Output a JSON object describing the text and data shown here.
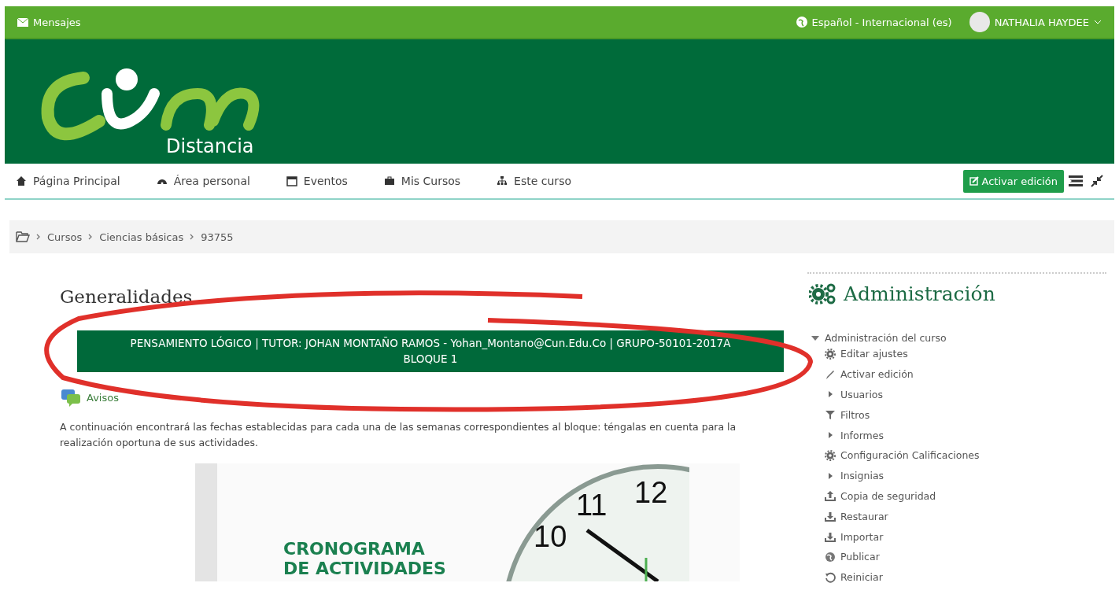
{
  "top_bar": {
    "messages": "Mensajes",
    "language": "Español - Internacional (es)",
    "user": "NATHALIA HAYDEE"
  },
  "logo": {
    "subtitle": "Distancia"
  },
  "nav": {
    "items": [
      {
        "label": "Página Principal"
      },
      {
        "label": "Área personal"
      },
      {
        "label": "Eventos"
      },
      {
        "label": "Mis Cursos"
      },
      {
        "label": "Este curso"
      }
    ],
    "edit_button": "Activar edición"
  },
  "breadcrumb": [
    "Cursos",
    "Ciencias básicas",
    "93755"
  ],
  "main": {
    "title": "Generalidades",
    "banner": [
      "PENSAMIENTO LÓGICO | TUTOR: JOHAN MONTAÑO RAMOS - Yohan_Montano@Cun.Edu.Co | GRUPO-50101-2017A",
      "BLOQUE 1"
    ],
    "forum_link": "Avisos",
    "intro": "A continuación encontrará las fechas establecidas para cada una de las semanas correspondientes al bloque: téngalas en cuenta para la realización oportuna de sus actividades.",
    "image": {
      "title_lines": [
        "CRONOGRAMA",
        "DE ACTIVIDADES"
      ],
      "clock_numbers": [
        "11",
        "12",
        "10"
      ]
    }
  },
  "admin": {
    "title": "Administración",
    "section": {
      "label": "Administración del curso",
      "expanded": true,
      "children": [
        {
          "label": "Editar ajustes",
          "kind": "gear"
        },
        {
          "label": "Activar edición",
          "kind": "pencil"
        },
        {
          "label": "Usuarios",
          "kind": "folder"
        },
        {
          "label": "Filtros",
          "kind": "filter"
        },
        {
          "label": "Informes",
          "kind": "folder"
        },
        {
          "label": "Configuración Calificaciones",
          "kind": "gear"
        },
        {
          "label": "Insignias",
          "kind": "folder"
        },
        {
          "label": "Copia de seguridad",
          "kind": "upload"
        },
        {
          "label": "Restaurar",
          "kind": "download"
        },
        {
          "label": "Importar",
          "kind": "download"
        },
        {
          "label": "Publicar",
          "kind": "globe"
        },
        {
          "label": "Reiniciar",
          "kind": "reset"
        }
      ]
    }
  }
}
